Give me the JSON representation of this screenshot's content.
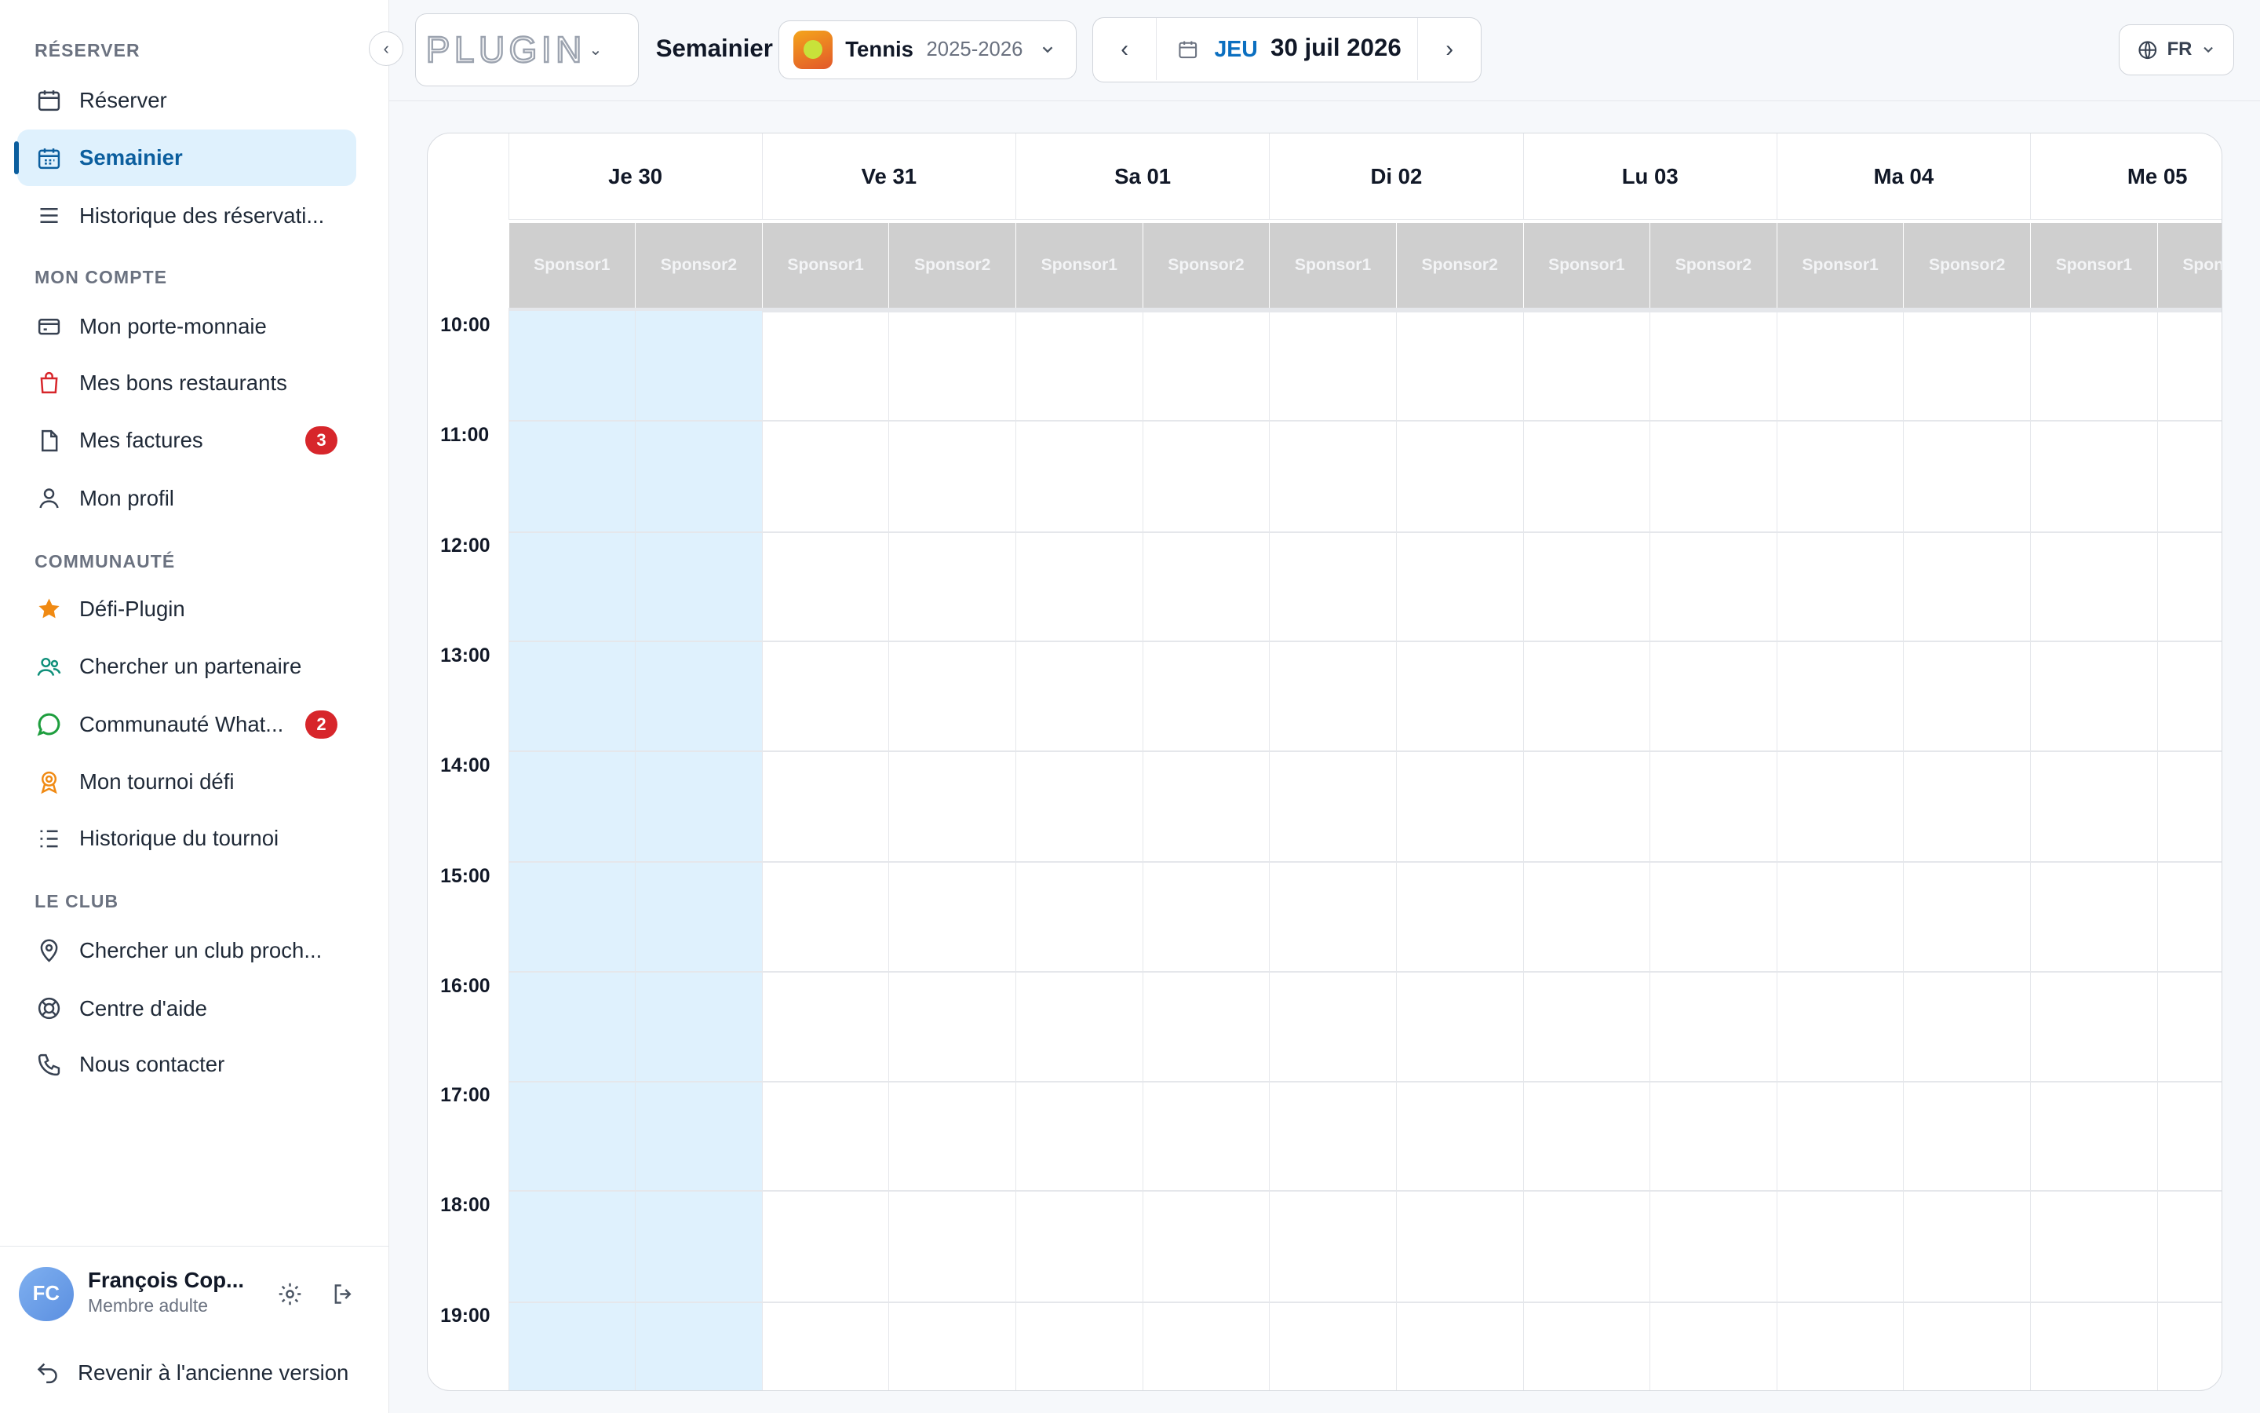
{
  "sidebar": {
    "sections": [
      {
        "title": "Réserver",
        "items": [
          {
            "label": "Réserver",
            "icon": "calendar-icon"
          },
          {
            "label": "Semainier",
            "icon": "calendar-grid-icon",
            "active": true
          },
          {
            "label": "Historique des réservati...",
            "icon": "list-icon"
          }
        ]
      },
      {
        "title": "Mon compte",
        "items": [
          {
            "label": "Mon porte-monnaie",
            "icon": "wallet-icon"
          },
          {
            "label": "Mes bons restaurants",
            "icon": "bag-icon"
          },
          {
            "label": "Mes factures",
            "icon": "file-icon",
            "badge": "3"
          },
          {
            "label": "Mon profil",
            "icon": "user-icon"
          }
        ]
      },
      {
        "title": "Communauté",
        "items": [
          {
            "label": "Défi-Plugin",
            "icon": "star-icon"
          },
          {
            "label": "Chercher un partenaire",
            "icon": "users-icon"
          },
          {
            "label": "Communauté What...",
            "icon": "chat-icon",
            "badge": "2"
          },
          {
            "label": "Mon tournoi défi",
            "icon": "medal-icon"
          },
          {
            "label": "Historique du tournoi",
            "icon": "checklist-icon"
          }
        ]
      },
      {
        "title": "Le club",
        "items": [
          {
            "label": "Chercher un club proch...",
            "icon": "pin-icon"
          },
          {
            "label": "Centre d'aide",
            "icon": "lifebuoy-icon"
          },
          {
            "label": "Nous contacter",
            "icon": "phone-icon"
          }
        ]
      }
    ],
    "user": {
      "initials": "FC",
      "name": "François Cop...",
      "role": "Membre adulte"
    },
    "back_label": "Revenir à l'ancienne version"
  },
  "topbar": {
    "logo": "PLUGIN",
    "page_title": "Semainier",
    "sport": "Tennis",
    "season": "2025-2026",
    "day_short": "JEU",
    "date": "30 juil 2026",
    "lang": "FR"
  },
  "calendar": {
    "days": [
      "Je 30",
      "Ve 31",
      "Sa 01",
      "Di 02",
      "Lu 03",
      "Ma 04",
      "Me 05"
    ],
    "courts": [
      "Sponsor1",
      "Sponsor2"
    ],
    "times": [
      "10:00",
      "11:00",
      "12:00",
      "13:00",
      "14:00",
      "15:00",
      "16:00",
      "17:00",
      "18:00",
      "19:00"
    ]
  },
  "colors": {
    "accent": "#0b5e9e",
    "today": "#dff1fd",
    "badge": "#d7262b",
    "court_header": "#cfcfcf"
  }
}
